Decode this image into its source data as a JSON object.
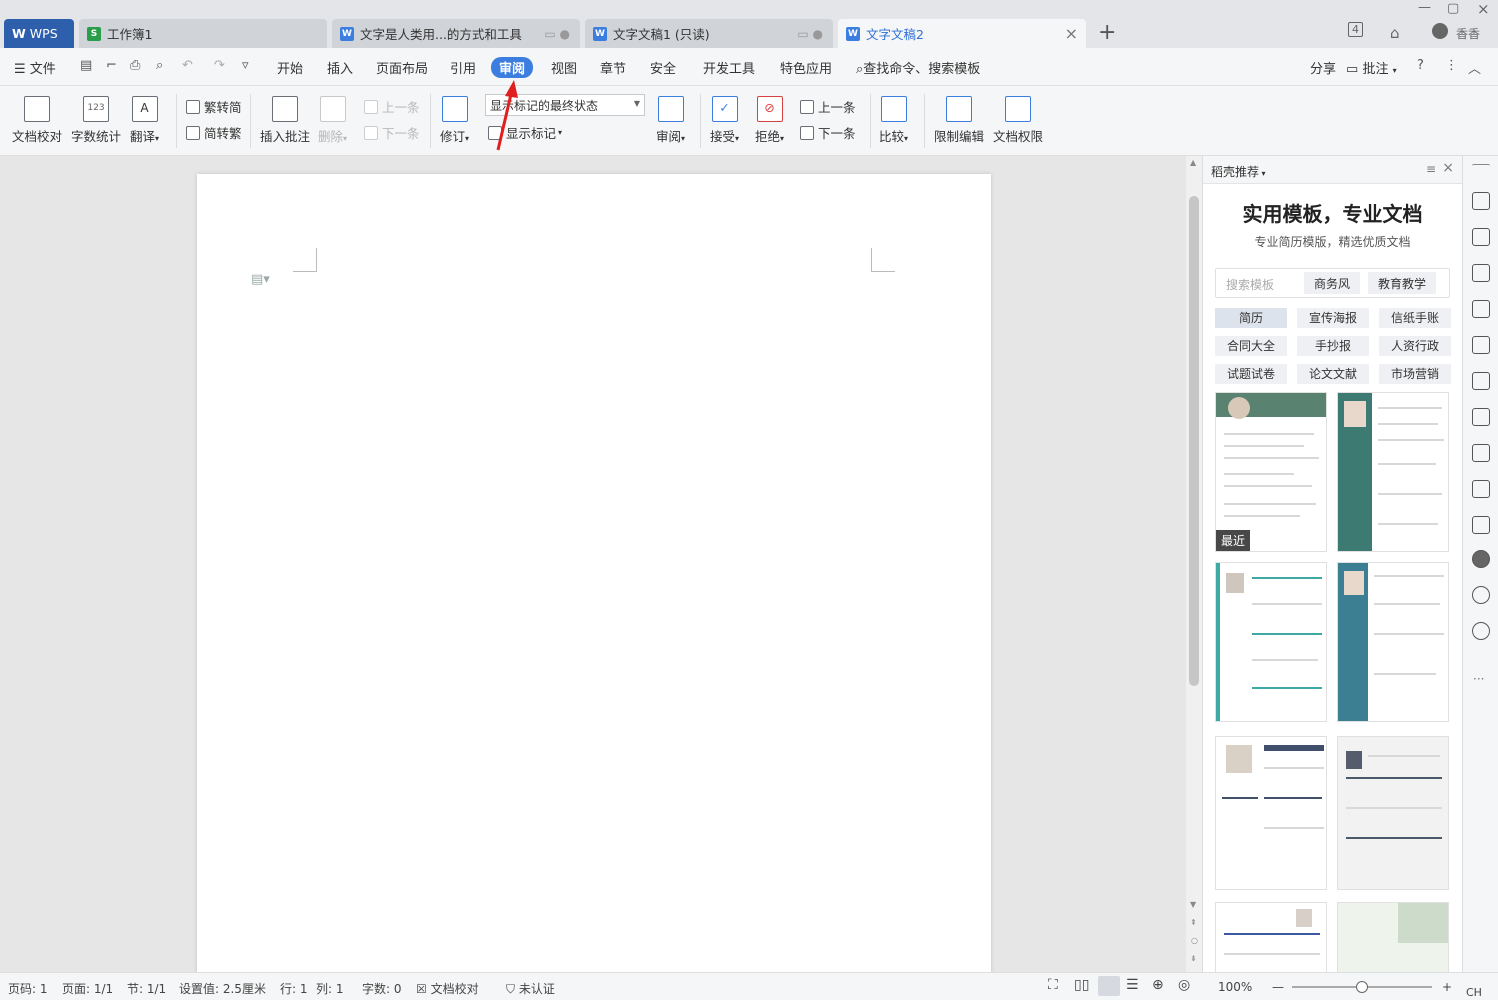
{
  "tabs": {
    "wps": "WPS",
    "workbook": "工作簿1",
    "doc_a": "文字是人类用...的方式和工具",
    "doc_b": "文字文稿1 (只读)",
    "doc_active": "文字文稿2",
    "user": "香香",
    "counter": "4"
  },
  "menu": {
    "file": "文件",
    "items": [
      "开始",
      "插入",
      "页面布局",
      "引用",
      "审阅",
      "视图",
      "章节",
      "安全",
      "开发工具",
      "特色应用"
    ],
    "search": "查找命令、搜索模板",
    "share": "分享",
    "comment": "批注"
  },
  "ribbon": {
    "proof": "文档校对",
    "wordcount": "字数统计",
    "translate": "翻译",
    "trad": "繁转简",
    "simp": "简转繁",
    "insert_comment": "插入批注",
    "delete": "删除",
    "prev": "上一条",
    "next": "下一条",
    "revise": "修订",
    "display_state": "显示标记的最终状态",
    "show_marks": "显示标记",
    "review": "审阅",
    "accept": "接受",
    "reject": "拒绝",
    "prev2": "上一条",
    "next2": "下一条",
    "compare": "比较",
    "restrict": "限制编辑",
    "rights": "文档权限"
  },
  "panel": {
    "header": "稻壳推荐",
    "title": "实用模板，专业文档",
    "subtitle": "专业简历模版，精选优质文档",
    "search_placeholder": "搜索模板",
    "pill1": "商务风",
    "pill2": "教育教学",
    "categories": [
      "简历",
      "宣传海报",
      "信纸手账",
      "合同大全",
      "手抄报",
      "人资行政",
      "试题试卷",
      "论文文献",
      "市场营销"
    ],
    "recent_badge": "最近"
  },
  "status": {
    "page_no": "页码: 1",
    "pages": "页面: 1/1",
    "section": "节: 1/1",
    "setting": "设置值: 2.5厘米",
    "row": "行: 1",
    "col": "列: 1",
    "words": "字数: 0",
    "proof": "文档校对",
    "cert": "未认证",
    "zoom": "100%",
    "ime": "CH"
  },
  "colors": {
    "accent": "#3b7ee0",
    "wps_tab": "#2d5fad",
    "arrow": "#e02020"
  }
}
